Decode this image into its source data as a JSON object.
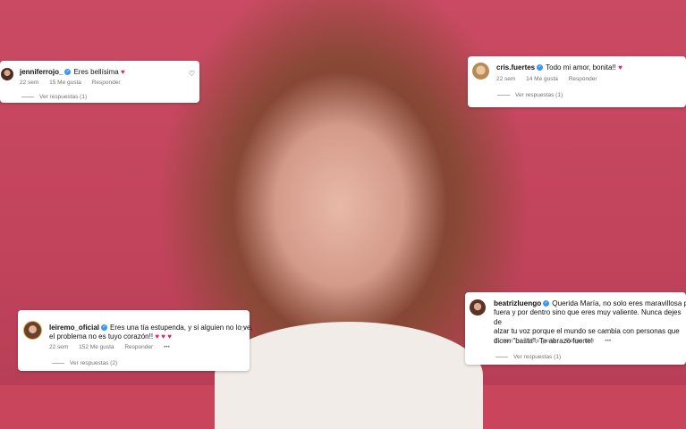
{
  "comments": [
    {
      "username": "jenniferrojo_",
      "text": "Eres bellísima",
      "heart": "♥",
      "age": "22 sem",
      "likes": "15 Me gusta",
      "reply": "Responder",
      "replies": "Ver respuestas (1)"
    },
    {
      "username": "cris.fuertes",
      "text": "Todo mi amor, bonita!!",
      "heart": "♥",
      "age": "22 sem",
      "likes": "14 Me gusta",
      "reply": "Responder",
      "replies": "Ver respuestas (1)"
    },
    {
      "username": "leiremo_oficial",
      "text": "Eres una tía estupenda, y si alguien no lo ve,",
      "text2": "el problema no es tuyo corazón!!",
      "hearts": "♥ ♥ ♥",
      "age": "22 sem",
      "likes": "152 Me gusta",
      "reply": "Responder",
      "more": "•••",
      "replies": "Ver respuestas (2)"
    },
    {
      "username": "beatrizluengo",
      "text": "Querida María, no solo eres maravillosa por",
      "lines": [
        "fuera y por dentro sino que eres muy valiente. Nunca dejes de",
        "alzar tu voz porque el mundo se cambia con personas que",
        "dicen \"basta\". Te abrazo fuerte!"
      ],
      "age": "21 sem",
      "likes": "75 Me gusta",
      "reply": "Responder",
      "more": "•••",
      "replies": "Ver respuestas (1)"
    }
  ],
  "icons": {
    "like": "heart-outline-icon",
    "verified": "verified-badge-icon"
  },
  "colors": {
    "background": "#c8455c",
    "verified": "#3897f0",
    "heart": "#e0245e"
  }
}
